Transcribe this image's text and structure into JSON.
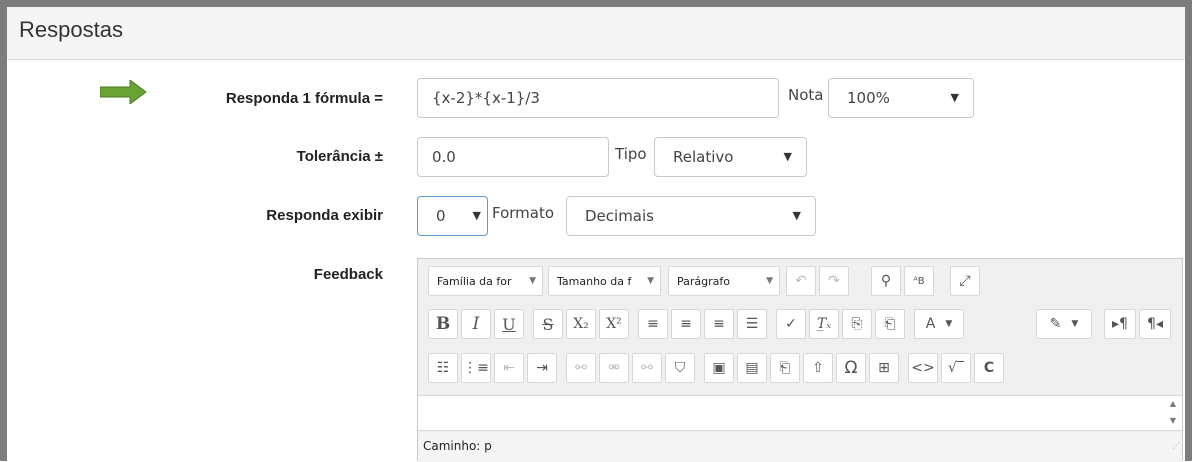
{
  "section": {
    "title": "Respostas"
  },
  "answer": {
    "formula_label": "Responda 1 fórmula =",
    "formula_value": "{x-2}*{x-1}/3",
    "grade_label": "Nota",
    "grade_value": "100%"
  },
  "tolerance": {
    "label": "Tolerância ±",
    "value": "0.0",
    "type_label": "Tipo",
    "type_value": "Relativo"
  },
  "display": {
    "label": "Responda exibir",
    "value": "0",
    "format_label": "Formato",
    "format_value": "Decimais"
  },
  "feedback": {
    "label": "Feedback",
    "font_family": "Família da for",
    "font_size": "Tamanho da f",
    "paragraph": "Parágrafo",
    "path": "Caminho: p"
  },
  "colors": {
    "arrow": "#6aa335",
    "header_bg": "#f5f5f5",
    "frame": "#7d7d7d"
  }
}
